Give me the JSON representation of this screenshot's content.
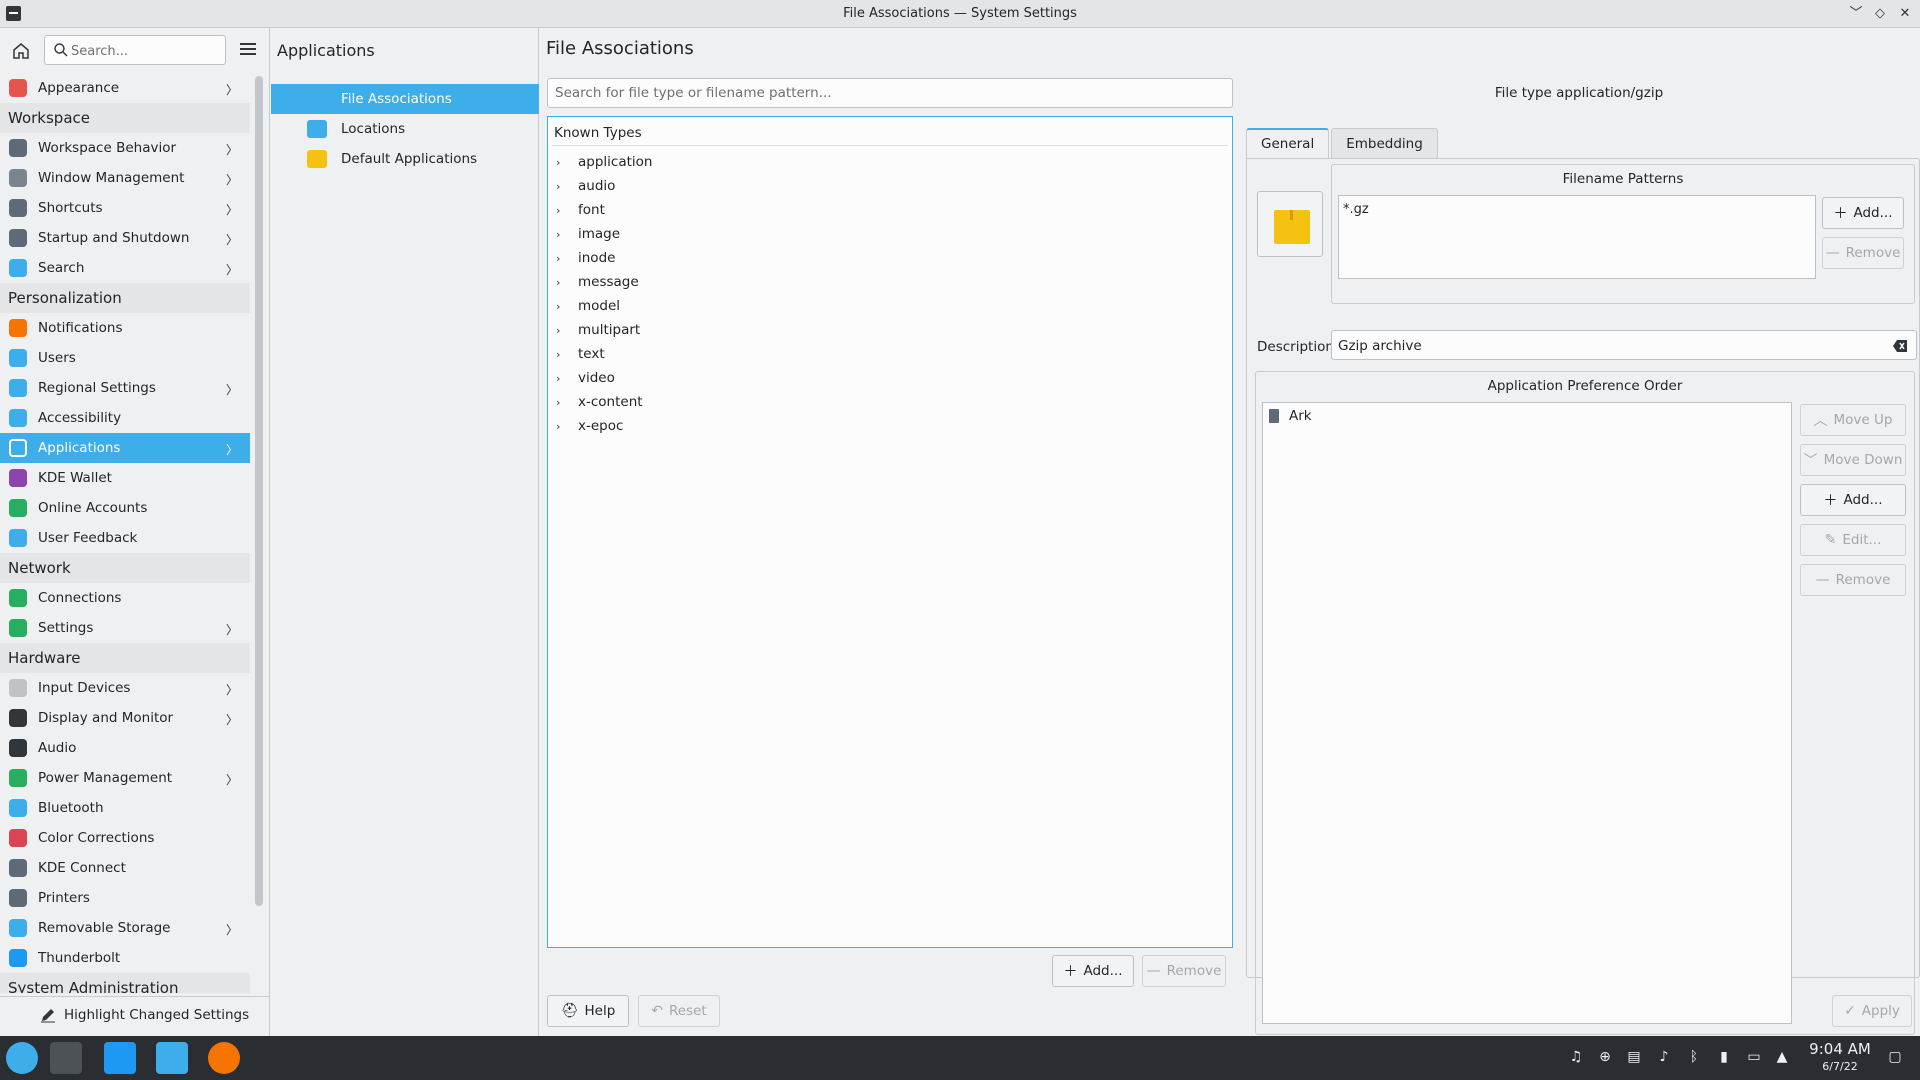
{
  "window": {
    "title": "File Associations — System Settings"
  },
  "sidebar": {
    "search_placeholder": "Search...",
    "items": [
      {
        "type": "item",
        "label": "Appearance",
        "icon": "appearance-icon",
        "color": "#e5554f",
        "chevron": true
      },
      {
        "type": "header",
        "label": "Workspace"
      },
      {
        "type": "item",
        "label": "Workspace Behavior",
        "icon": "workspace-behavior-icon",
        "color": "#5e6a75",
        "chevron": true
      },
      {
        "type": "item",
        "label": "Window Management",
        "icon": "window-management-icon",
        "color": "#7a8590",
        "chevron": true
      },
      {
        "type": "item",
        "label": "Shortcuts",
        "icon": "keyboard-icon",
        "color": "#5e6a75",
        "chevron": true
      },
      {
        "type": "item",
        "label": "Startup and Shutdown",
        "icon": "startup-icon",
        "color": "#5e6a75",
        "chevron": true
      },
      {
        "type": "item",
        "label": "Search",
        "icon": "search-icon",
        "color": "#3daee9",
        "chevron": true
      },
      {
        "type": "header",
        "label": "Personalization"
      },
      {
        "type": "item",
        "label": "Notifications",
        "icon": "bell-icon",
        "color": "#f67400",
        "chevron": false
      },
      {
        "type": "item",
        "label": "Users",
        "icon": "users-icon",
        "color": "#3daee9",
        "chevron": false
      },
      {
        "type": "item",
        "label": "Regional Settings",
        "icon": "regional-icon",
        "color": "#3daee9",
        "chevron": true
      },
      {
        "type": "item",
        "label": "Accessibility",
        "icon": "accessibility-icon",
        "color": "#3daee9",
        "chevron": false
      },
      {
        "type": "item",
        "label": "Applications",
        "icon": "applications-icon",
        "color": "#ffffff",
        "chevron": true,
        "active": true
      },
      {
        "type": "item",
        "label": "KDE Wallet",
        "icon": "wallet-icon",
        "color": "#8e44ad",
        "chevron": false
      },
      {
        "type": "item",
        "label": "Online Accounts",
        "icon": "online-accounts-icon",
        "color": "#27ae60",
        "chevron": false
      },
      {
        "type": "item",
        "label": "User Feedback",
        "icon": "feedback-icon",
        "color": "#3daee9",
        "chevron": false
      },
      {
        "type": "header",
        "label": "Network"
      },
      {
        "type": "item",
        "label": "Connections",
        "icon": "globe-icon",
        "color": "#27ae60",
        "chevron": false
      },
      {
        "type": "item",
        "label": "Settings",
        "icon": "network-settings-icon",
        "color": "#27ae60",
        "chevron": true
      },
      {
        "type": "header",
        "label": "Hardware"
      },
      {
        "type": "item",
        "label": "Input Devices",
        "icon": "mouse-icon",
        "color": "#bdc3c7",
        "chevron": true
      },
      {
        "type": "item",
        "label": "Display and Monitor",
        "icon": "monitor-icon",
        "color": "#31363b",
        "chevron": true
      },
      {
        "type": "item",
        "label": "Audio",
        "icon": "speaker-icon",
        "color": "#31363b",
        "chevron": false
      },
      {
        "type": "item",
        "label": "Power Management",
        "icon": "power-icon",
        "color": "#27ae60",
        "chevron": true
      },
      {
        "type": "item",
        "label": "Bluetooth",
        "icon": "bluetooth-icon",
        "color": "#3daee9",
        "chevron": false
      },
      {
        "type": "item",
        "label": "Color Corrections",
        "icon": "color-wheel-icon",
        "color": "#da4453",
        "chevron": false
      },
      {
        "type": "item",
        "label": "KDE Connect",
        "icon": "phone-icon",
        "color": "#5e6a75",
        "chevron": false
      },
      {
        "type": "item",
        "label": "Printers",
        "icon": "printer-icon",
        "color": "#5e6a75",
        "chevron": false
      },
      {
        "type": "item",
        "label": "Removable Storage",
        "icon": "usb-icon",
        "color": "#3daee9",
        "chevron": true
      },
      {
        "type": "item",
        "label": "Thunderbolt",
        "icon": "thunderbolt-icon",
        "color": "#1d99f3",
        "chevron": false
      },
      {
        "type": "header",
        "label": "System Administration"
      }
    ],
    "footer_label": "Highlight Changed Settings"
  },
  "middle": {
    "heading": "Applications",
    "items": [
      {
        "label": "File Associations",
        "icon": "file-associations-icon",
        "color": "#3daee9",
        "active": true
      },
      {
        "label": "Locations",
        "icon": "folder-icon",
        "color": "#3daee9",
        "active": false
      },
      {
        "label": "Default Applications",
        "icon": "star-icon",
        "color": "#f5c211",
        "active": false
      }
    ]
  },
  "main": {
    "title": "File Associations",
    "search_placeholder": "Search for file type or filename pattern...",
    "tree_header": "Known Types",
    "types": [
      "application",
      "audio",
      "font",
      "image",
      "inode",
      "message",
      "model",
      "multipart",
      "text",
      "video",
      "x-content",
      "x-epoc"
    ],
    "add_label": "Add...",
    "remove_label": "Remove",
    "help_label": "Help",
    "reset_label": "Reset",
    "apply_label": "Apply"
  },
  "details": {
    "file_type_label": "File type application/gzip",
    "tabs": [
      "General",
      "Embedding"
    ],
    "filename_patterns_title": "Filename Patterns",
    "patterns": [
      "*.gz"
    ],
    "add_label": "Add...",
    "remove_label": "Remove",
    "description_label": "Description:",
    "description_value": "Gzip archive",
    "app_pref_title": "Application Preference Order",
    "apps": [
      "Ark"
    ],
    "move_up_label": "Move Up",
    "move_down_label": "Move Down",
    "app_add_label": "Add...",
    "edit_label": "Edit...",
    "app_remove_label": "Remove"
  },
  "taskbar": {
    "time": "9:04 AM",
    "date": "6/7/22"
  },
  "colors": {
    "accent": "#3daee9",
    "taskbar": "#2a2e32"
  }
}
